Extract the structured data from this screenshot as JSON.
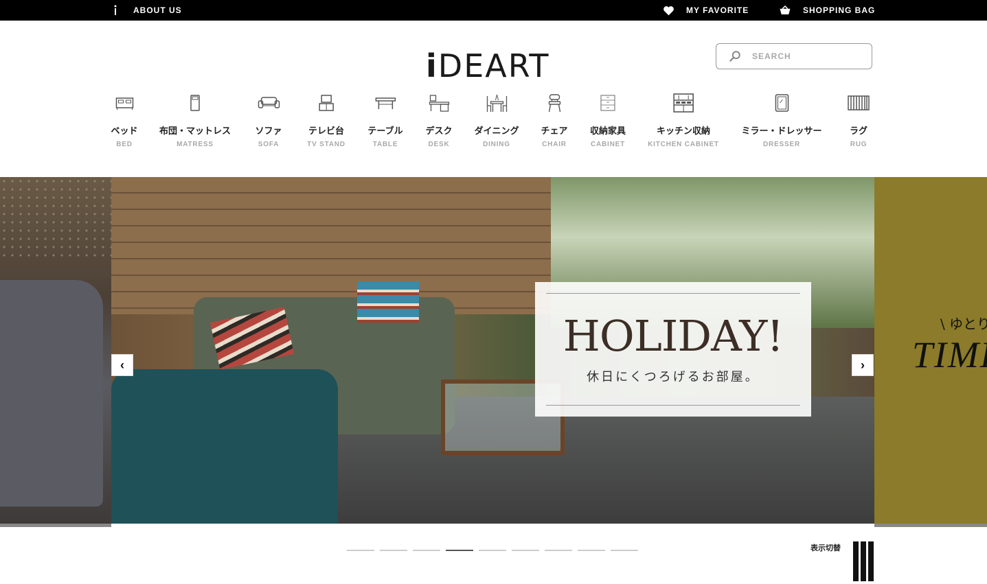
{
  "topbar": {
    "about": "ABOUT US",
    "favorite": "MY FAVORITE",
    "bag": "SHOPPING BAG"
  },
  "logo": {
    "i": "i",
    "rest": "DEART"
  },
  "search": {
    "placeholder": "SEARCH"
  },
  "categories": [
    {
      "jp": "ベッド",
      "en": "BED",
      "icon": "bed-icon"
    },
    {
      "jp": "布団・マットレス",
      "en": "MATRESS",
      "icon": "mattress-icon"
    },
    {
      "jp": "ソファ",
      "en": "SOFA",
      "icon": "sofa-icon"
    },
    {
      "jp": "テレビ台",
      "en": "TV STAND",
      "icon": "tv-stand-icon"
    },
    {
      "jp": "テーブル",
      "en": "TABLE",
      "icon": "table-icon"
    },
    {
      "jp": "デスク",
      "en": "DESK",
      "icon": "desk-icon"
    },
    {
      "jp": "ダイニング",
      "en": "DINING",
      "icon": "dining-icon"
    },
    {
      "jp": "チェア",
      "en": "CHAIR",
      "icon": "chair-icon"
    },
    {
      "jp": "収納家具",
      "en": "CABINET",
      "icon": "cabinet-icon"
    },
    {
      "jp": "キッチン収納",
      "en": "KITCHEN CABINET",
      "icon": "kitchen-cabinet-icon"
    },
    {
      "jp": "ミラー・ドレッサー",
      "en": "DRESSER",
      "icon": "dresser-icon"
    },
    {
      "jp": "ラグ",
      "en": "RUG",
      "icon": "rug-icon"
    }
  ],
  "hero": {
    "title": "HOLIDAY!",
    "subtitle": "休日にくつろげるお部屋。",
    "next_slide_jp": "\\ ゆとり",
    "next_slide_en": "TIME",
    "prev_arrow": "‹",
    "next_arrow": "›"
  },
  "pager": {
    "count": 9,
    "active_index": 3
  },
  "view_toggle": {
    "label": "表示切替"
  },
  "colors": {
    "topbar_bg": "#000000",
    "accent_olive": "#8b7b2a",
    "muted_text": "#a8a8a8"
  }
}
